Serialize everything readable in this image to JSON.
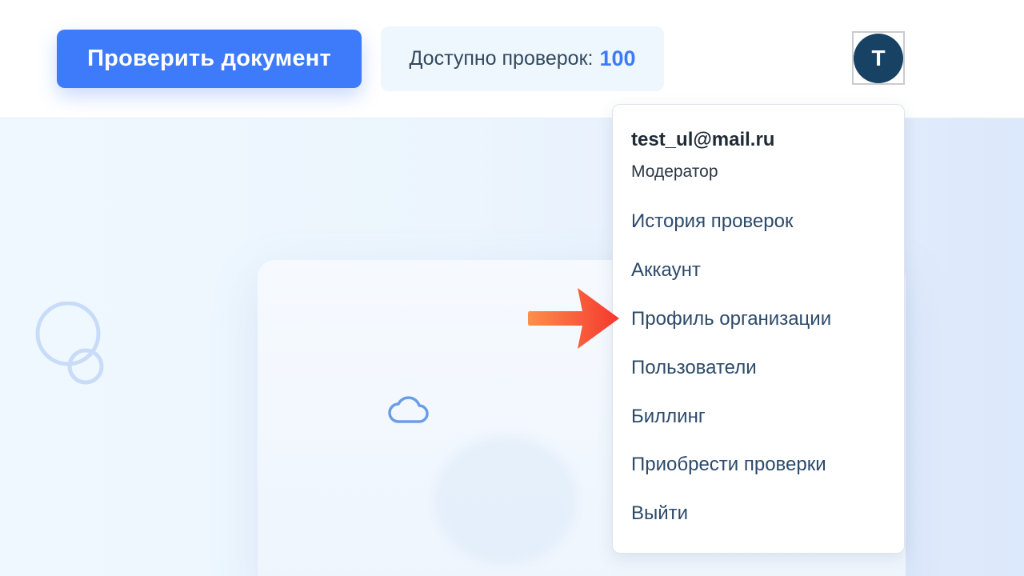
{
  "header": {
    "check_button_label": "Проверить документ",
    "quota_label": "Доступно проверок:",
    "quota_value": "100",
    "avatar_letter": "T"
  },
  "user_menu": {
    "email": "test_ul@mail.ru",
    "role": "Модератор",
    "items": [
      {
        "label": "История проверок"
      },
      {
        "label": "Аккаунт"
      },
      {
        "label": "Профиль организации"
      },
      {
        "label": "Пользователи"
      },
      {
        "label": "Биллинг"
      },
      {
        "label": "Приобрести проверки"
      },
      {
        "label": "Выйти"
      }
    ]
  },
  "colors": {
    "primary": "#3e7bfa",
    "avatar_bg": "#174263",
    "menu_text": "#2c4a6a",
    "annotation_arrow": "#f5483a"
  },
  "icons": {
    "pointer_arrow": "arrow-right-icon",
    "background_logo": "logo-outline-icon",
    "cloud": "cloud-icon"
  }
}
